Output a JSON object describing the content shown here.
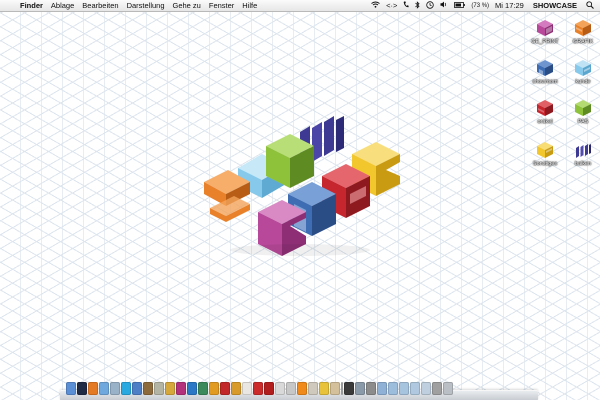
{
  "menubar": {
    "apple_glyph": "",
    "items": [
      "Finder",
      "Ablage",
      "Bearbeiten",
      "Darstellung",
      "Gehe zu",
      "Fenster",
      "Hilfe"
    ],
    "status": {
      "wifi_icon": "wifi-icon",
      "sync_text": "<·>",
      "battery_text": "(73 %)",
      "clock": "Mi 17:29",
      "user": "SHOWCASE"
    }
  },
  "colors": {
    "magenta": "#b8499a",
    "orange": "#e8812a",
    "blue": "#3f6db4",
    "sky": "#86c9ea",
    "red": "#c6262e",
    "green": "#8dc23a",
    "yellow": "#f2c62d",
    "violet": "#3e3a94"
  },
  "desktop_icons": [
    {
      "label": "GE_PRINT",
      "color": "magenta"
    },
    {
      "label": "GRAFIK",
      "color": "orange"
    },
    {
      "label": "showroom",
      "color": "blue"
    },
    {
      "label": "kunde",
      "color": "sky"
    },
    {
      "label": "orakel",
      "color": "red"
    },
    {
      "label": "PAS",
      "color": "green"
    },
    {
      "label": "Sonstiges",
      "color": "yellow"
    },
    {
      "label": "balken",
      "color": "violet"
    }
  ]
}
